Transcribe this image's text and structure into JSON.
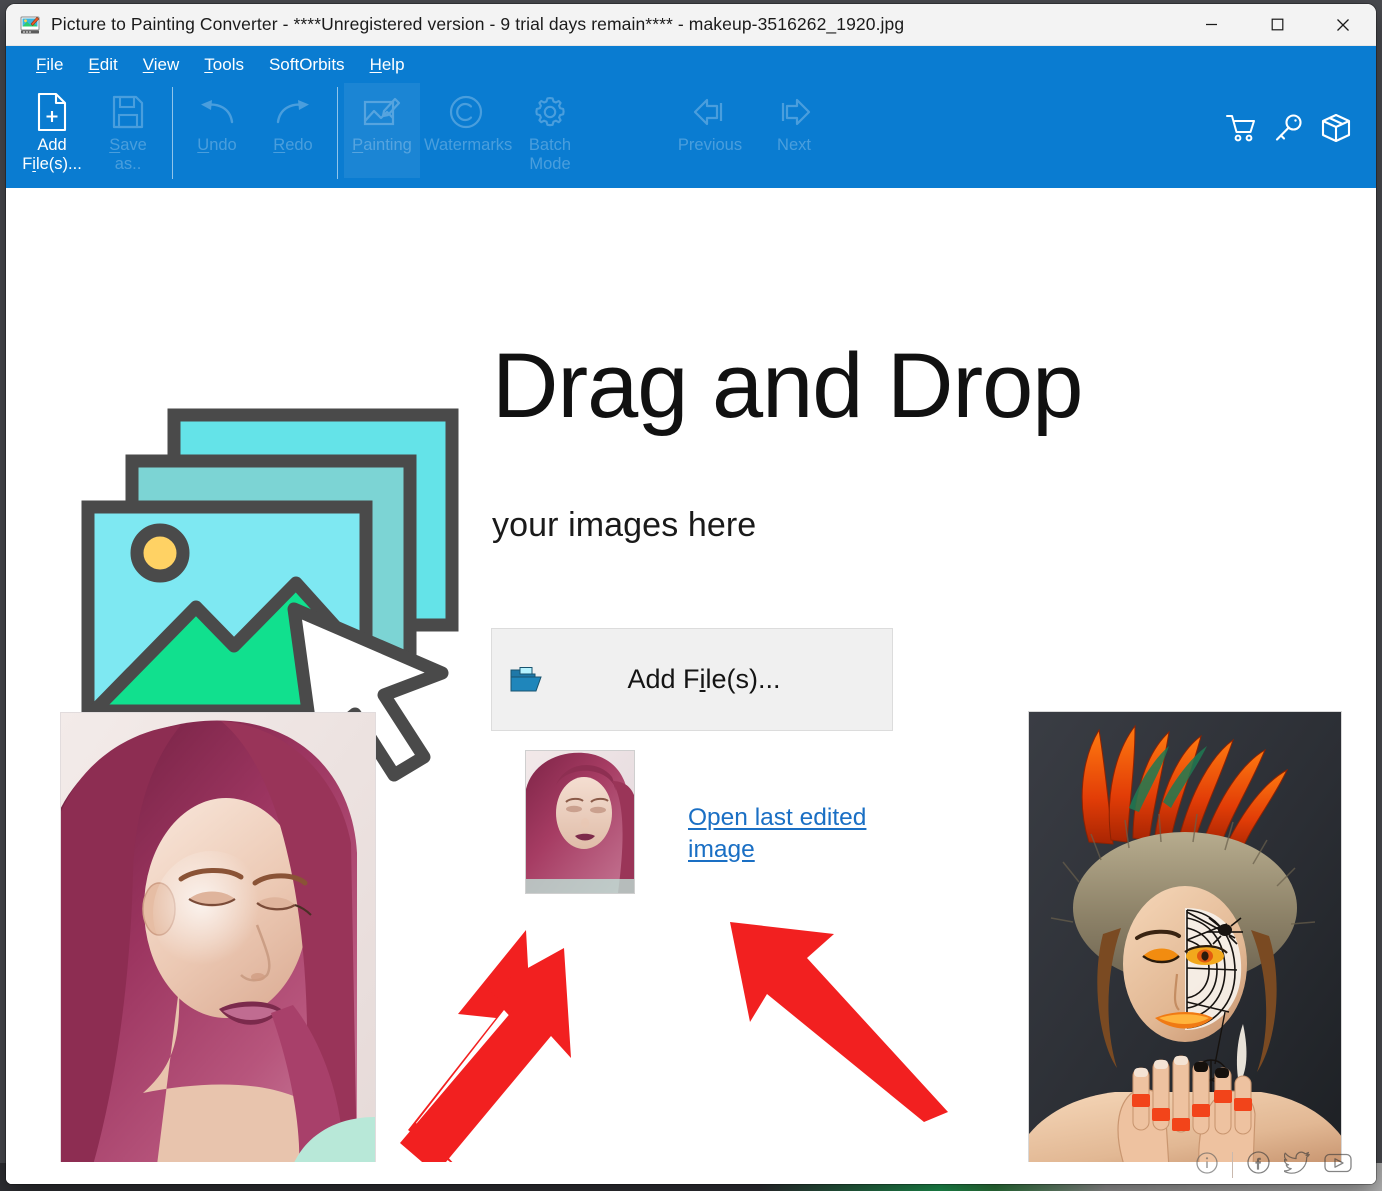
{
  "window": {
    "title": "Picture to Painting Converter - ****Unregistered version - 9 trial days remain**** - makeup-3516262_1920.jpg",
    "app_icon_name": "picture-to-painting-app-icon",
    "controls": {
      "minimize": "—",
      "maximize": "□",
      "close": "✕"
    }
  },
  "menubar": {
    "items": [
      {
        "label": "File",
        "accesskey": "F",
        "pre": "",
        "post": "ile"
      },
      {
        "label": "Edit",
        "accesskey": "E",
        "pre": "",
        "post": "dit"
      },
      {
        "label": "View",
        "accesskey": "V",
        "pre": "",
        "post": "iew"
      },
      {
        "label": "Tools",
        "accesskey": "T",
        "pre": "",
        "post": "ools"
      },
      {
        "label": "SoftOrbits",
        "accesskey": "",
        "pre": "SoftOrbits",
        "post": ""
      },
      {
        "label": "Help",
        "accesskey": "H",
        "pre": "",
        "post": "elp"
      }
    ]
  },
  "toolbar": {
    "background_color": "#0a7cd1",
    "buttons": [
      {
        "name": "add-files",
        "label": "Add\nFile(s)...",
        "icon": "document-plus-icon",
        "enabled": true,
        "highlight": false
      },
      {
        "name": "save-as",
        "label": "Save\nas..",
        "icon": "floppy-disk-icon",
        "enabled": false,
        "highlight": false
      },
      {
        "name": "undo",
        "label": "Undo",
        "icon": "undo-arrow-icon",
        "enabled": false,
        "highlight": false
      },
      {
        "name": "redo",
        "label": "Redo",
        "icon": "redo-arrow-icon",
        "enabled": false,
        "highlight": false
      },
      {
        "name": "painting",
        "label": "Painting",
        "icon": "picture-pencil-icon",
        "enabled": false,
        "highlight": true
      },
      {
        "name": "watermarks",
        "label": "Watermarks",
        "icon": "copyright-icon",
        "enabled": false,
        "highlight": false
      },
      {
        "name": "batch-mode",
        "label": "Batch\nMode",
        "icon": "gear-icon",
        "enabled": false,
        "highlight": false
      },
      {
        "name": "previous",
        "label": "Previous",
        "icon": "arrow-left-icon",
        "enabled": false,
        "highlight": false
      },
      {
        "name": "next",
        "label": "Next",
        "icon": "arrow-right-icon",
        "enabled": false,
        "highlight": false
      }
    ],
    "right_icons": [
      {
        "name": "shopping-cart-icon",
        "title": "Buy"
      },
      {
        "name": "key-icon",
        "title": "Register"
      },
      {
        "name": "box-icon",
        "title": "Products"
      }
    ]
  },
  "main": {
    "drop_title": "Drag and Drop",
    "drop_subtitle": "your images here",
    "illustration_name": "drag-drop-images-cursor-illustration",
    "add_files_button": {
      "label": "Add File(s)...",
      "label_pre": "Add F",
      "label_key": "i",
      "label_post": "le(s)...",
      "icon": "open-folder-icon"
    },
    "open_last_link": "Open last edited image",
    "last_edited_thumbnail_name": "last-edited-image-thumbnail",
    "photo_left_name": "sample-photo-pink-hair-portrait",
    "photo_right_name": "sample-photo-feather-headdress-portrait",
    "arrows": [
      {
        "name": "red-arrow-pointing-to-thumbnail",
        "direction": "up-right"
      },
      {
        "name": "red-arrow-pointing-to-open-last-link",
        "direction": "up-left"
      }
    ],
    "accent_red": "#f22020"
  },
  "social": {
    "icons": [
      {
        "name": "info-icon",
        "glyph": "i"
      },
      {
        "name": "facebook-icon",
        "glyph": "f"
      },
      {
        "name": "twitter-icon",
        "glyph": "t"
      },
      {
        "name": "youtube-icon",
        "glyph": "▶"
      }
    ]
  },
  "colors": {
    "titlebar": "#f3f3f3",
    "menubar": "#0a7cd1",
    "link": "#1a6fc4",
    "button_face": "#f0f0f0",
    "arrow_red": "#f22020"
  }
}
